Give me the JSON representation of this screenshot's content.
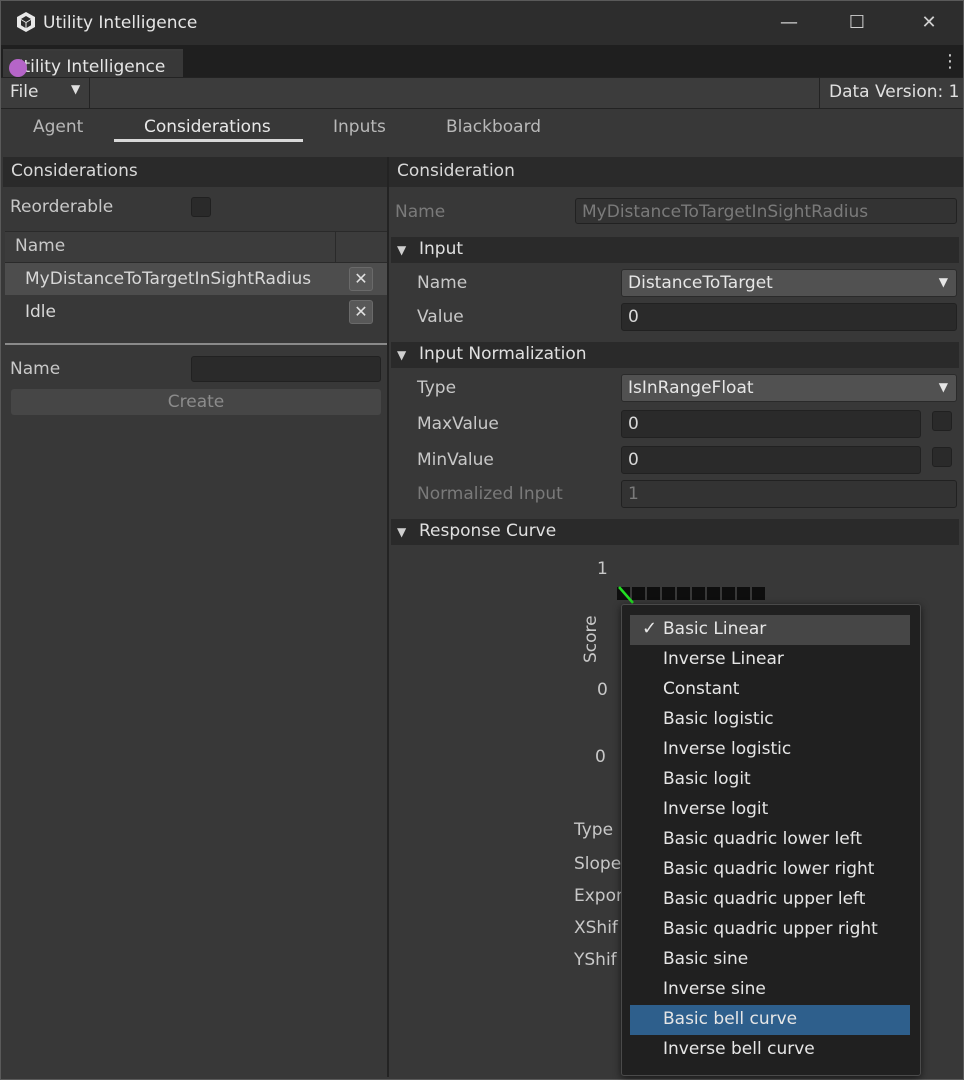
{
  "window": {
    "title": "Utility Intelligence",
    "doc_tab": "Utility Intelligence",
    "minimize": "—",
    "maximize": "☐",
    "close": "✕",
    "kebab": "⋮"
  },
  "toolbar": {
    "file_label": "File",
    "file_arrow": "▼",
    "data_version": "Data Version: 1"
  },
  "tabs": [
    "Agent",
    "Considerations",
    "Inputs",
    "Blackboard"
  ],
  "active_tab": "Considerations",
  "left": {
    "header": "Considerations",
    "reorderable_label": "Reorderable",
    "list_header": "Name",
    "items": [
      {
        "label": "MyDistanceToTargetInSightRadius",
        "delete": "✕"
      },
      {
        "label": "Idle",
        "delete": "✕"
      }
    ],
    "name_label": "Name",
    "name_value": "",
    "create_label": "Create"
  },
  "right": {
    "header": "Consideration",
    "name_label": "Name",
    "name_value": "MyDistanceToTargetInSightRadius",
    "input": {
      "title": "Input",
      "name_label": "Name",
      "name_value": "DistanceToTarget",
      "value_label": "Value",
      "value": "0"
    },
    "normalization": {
      "title": "Input Normalization",
      "type_label": "Type",
      "type_value": "IsInRangeFloat",
      "max_label": "MaxValue",
      "max_value": "0",
      "min_label": "MinValue",
      "min_value": "0",
      "normalized_label": "Normalized Input",
      "normalized_value": "1"
    },
    "response": {
      "title": "Response Curve",
      "y_top": "1",
      "y_bottom": "0",
      "x_zero": "0",
      "y_axis_label": "Score",
      "field_labels": [
        "Type",
        "Slope",
        "Expon",
        "XShif",
        "YShif"
      ]
    }
  },
  "curve_popup": {
    "selected": "Basic Linear",
    "highlighted": "Basic bell curve",
    "check": "✓",
    "items": [
      "Basic Linear",
      "Inverse Linear",
      "Constant",
      "Basic logistic",
      "Inverse logistic",
      "Basic logit",
      "Inverse logit",
      "Basic quadric lower left",
      "Basic quadric lower right",
      "Basic quadric upper left",
      "Basic quadric upper right",
      "Basic sine",
      "Inverse sine",
      "Basic bell curve",
      "Inverse bell curve"
    ]
  },
  "colors": {
    "highlight": "#2e5f8c",
    "curve": "#22dd22",
    "app_dot": "#b565c8"
  },
  "icons": {
    "app": "unity-logo-icon",
    "collapse": "triangle-down-icon",
    "dropdown": "chevron-down-icon"
  }
}
